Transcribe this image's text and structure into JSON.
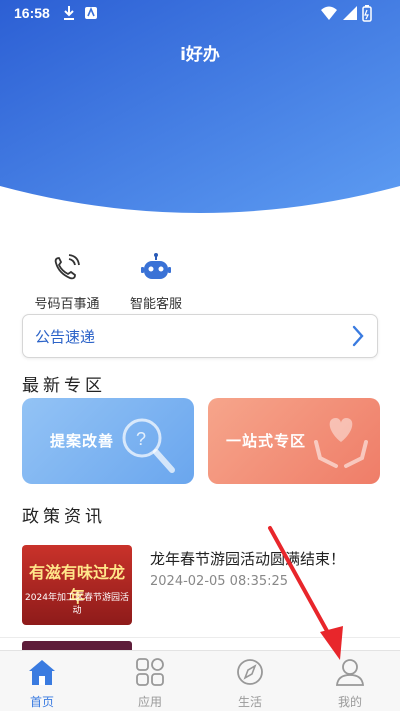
{
  "status_bar": {
    "time": "16:58"
  },
  "header": {
    "title": "i好办"
  },
  "quick_actions": [
    {
      "label": "号码百事通",
      "icon": "phone-signal-icon"
    },
    {
      "label": "智能客服",
      "icon": "robot-icon"
    }
  ],
  "notice": {
    "label": "公告速递"
  },
  "featured": {
    "title": "最新专区",
    "cards": [
      {
        "label": "提案改善",
        "icon": "magnifier-icon"
      },
      {
        "label": "一站式专区",
        "icon": "heart-hands-icon"
      }
    ]
  },
  "policy": {
    "title": "政策资讯",
    "items": [
      {
        "thumb_title": "有滋有味过龙年",
        "thumb_subtitle": "2024年加工区春节游园活动",
        "headline": "龙年春节游园活动圆满结束！",
        "date": "2024-02-05 08:35:25"
      }
    ]
  },
  "tab_bar": {
    "tabs": [
      {
        "label": "首页",
        "icon": "home-icon",
        "active": true
      },
      {
        "label": "应用",
        "icon": "apps-grid-icon",
        "active": false
      },
      {
        "label": "生活",
        "icon": "compass-icon",
        "active": false
      },
      {
        "label": "我的",
        "icon": "user-icon",
        "active": false
      }
    ]
  },
  "colors": {
    "accent": "#3a7be0",
    "header_top": "#2f67d8",
    "header_bottom": "#5b97f0",
    "annotation_arrow": "#e8262b"
  }
}
